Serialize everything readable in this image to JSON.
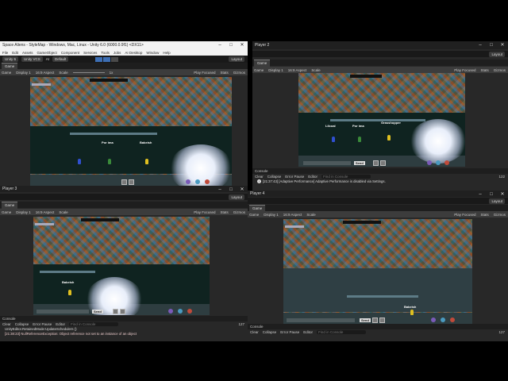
{
  "main_window": {
    "title": "Space Aliens - StyleMap - Windows, Mac, Linux - Unity 6.0 (6000.0.9f1) <DX11>",
    "menu": [
      "File",
      "Edit",
      "Assets",
      "GameObject",
      "Component",
      "Services",
      "Tools",
      "Jobs",
      "AI Desktop",
      "Window",
      "Help"
    ],
    "unity_label": "Unity 6",
    "vcs_label": "Unity VCS",
    "ai_label": "AI",
    "build_profile": "Default",
    "layout_label": "Layout",
    "panel_tab": "Game",
    "display": "Display 1",
    "aspect": "16:9 Aspect",
    "scale_label": "Scale",
    "scale_value": "1x",
    "play_focused": "Play Focused",
    "stats": "Stats",
    "gizmos": "Gizmos"
  },
  "player2_window": {
    "title": "Player 2",
    "layout_label": "Layout",
    "panel_tab": "Game",
    "display": "Display 1",
    "aspect": "16:9 Aspect",
    "scale_label": "Scale",
    "play_focused": "Play Focused",
    "stats": "Stats",
    "gizmos": "Gizmos",
    "console_tab": "Console",
    "console_buttons": [
      "Clear",
      "Collapse",
      "Error Pause",
      "Editor"
    ],
    "search_placeholder": "Find in Console",
    "console_count": "122",
    "log_message": "[21:37:43] [Adaptive Performance] Adaptive Performance is disabled via Settings."
  },
  "player3_window": {
    "title": "Player 3",
    "layout_label": "Layout",
    "panel_tab": "Game",
    "display": "Display 1",
    "aspect": "16:9 Aspect",
    "scale_label": "Scale",
    "play_focused": "Play Focused",
    "stats": "Stats",
    "gizmos": "Gizmos",
    "console_tab": "Console",
    "console_buttons": [
      "Clear",
      "Collapse",
      "Error Pause",
      "Editor"
    ],
    "search_placeholder": "Find in Console",
    "console_count": "127",
    "log_line1": "UnityEditor.RetainedMode:UpdateSchedulers ()",
    "log_line2": "[21:38:23] NullReferenceException: Object reference not set to an instance of an object"
  },
  "player4_window": {
    "title": "Player 4",
    "layout_label": "Layout",
    "panel_tab": "Game",
    "display": "Display 1",
    "aspect": "16:9 Aspect",
    "scale_label": "Scale",
    "play_focused": "Play Focused",
    "stats": "Stats",
    "gizmos": "Gizmos",
    "console_tab": "Console",
    "console_buttons": [
      "Clear",
      "Collapse",
      "Error Pause",
      "Editor"
    ],
    "search_placeholder": "Find in Console",
    "console_count": "127"
  },
  "game": {
    "player_names": [
      "Lilcoal",
      "Por ima",
      "Grasshopper",
      "Bakeish"
    ],
    "send_label": "Send"
  },
  "colors": {
    "editor_bg": "#282828",
    "accent_blue": "#3d6fb5",
    "titlebar_light": "#f3f3f3",
    "effect_glow": "#e8eefa"
  }
}
